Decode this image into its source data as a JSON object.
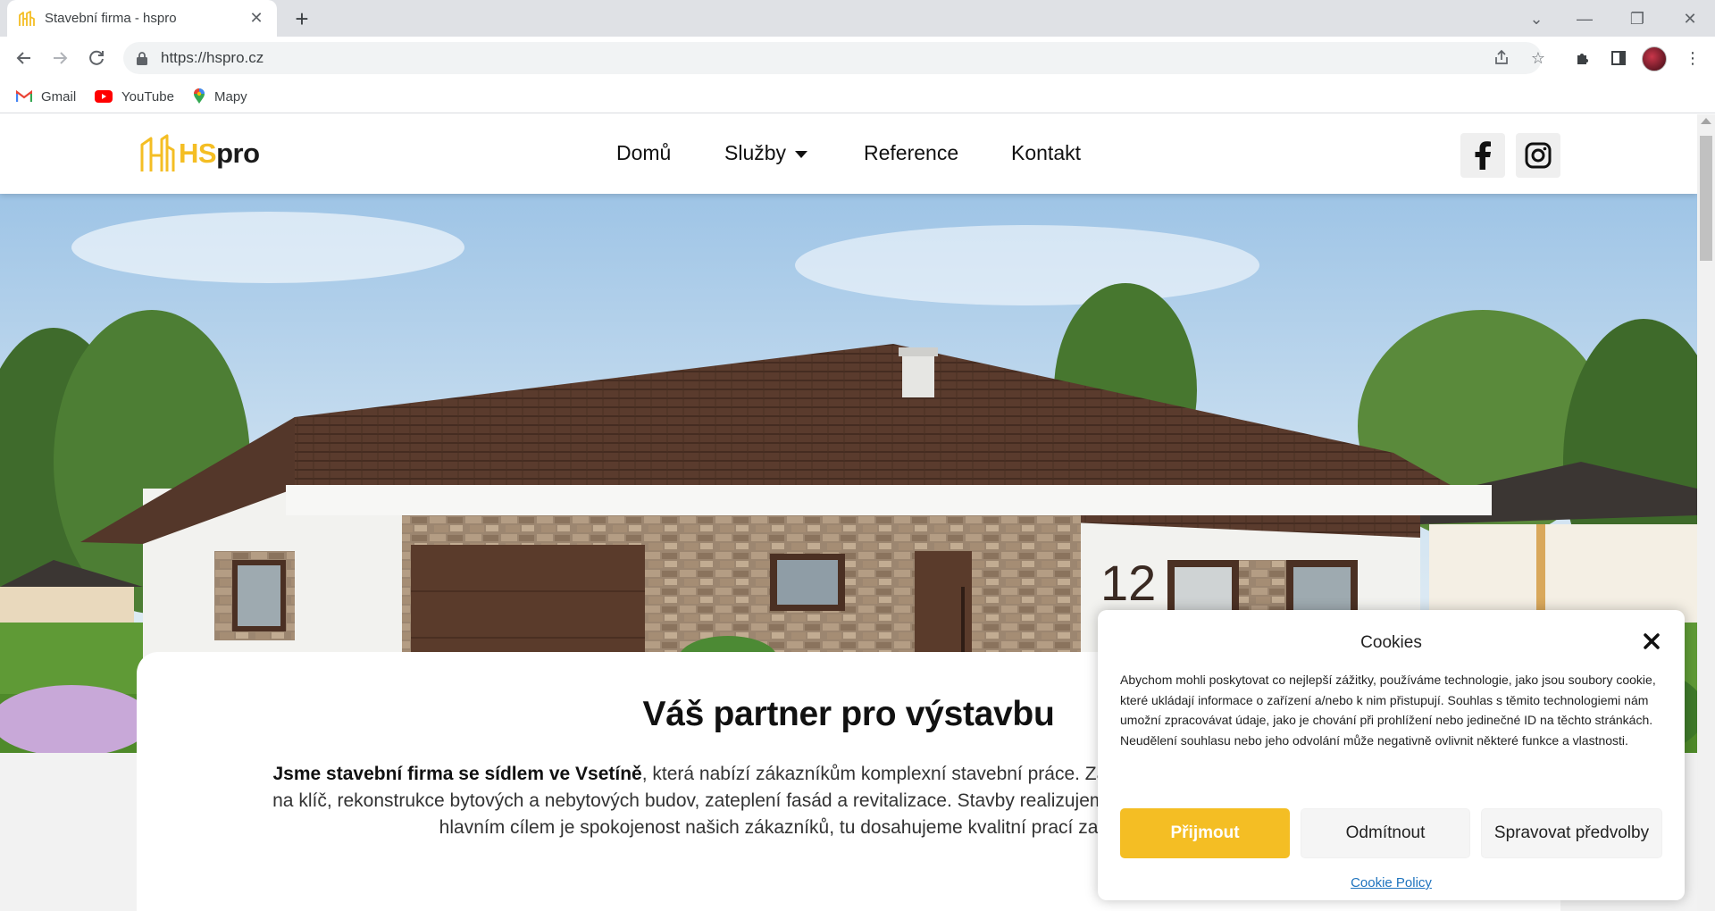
{
  "browser": {
    "tab_title": "Stavební firma - hspro",
    "url": "https://hspro.cz",
    "bookmarks": [
      {
        "label": "Gmail",
        "icon": "gmail-icon"
      },
      {
        "label": "YouTube",
        "icon": "youtube-icon"
      },
      {
        "label": "Mapy",
        "icon": "maps-pin-icon"
      }
    ]
  },
  "site": {
    "logo": {
      "hs": "HS",
      "pro": "pro"
    },
    "nav": [
      {
        "label": "Domů"
      },
      {
        "label": "Služby",
        "has_dropdown": true
      },
      {
        "label": "Reference"
      },
      {
        "label": "Kontakt"
      }
    ],
    "social": [
      "facebook-icon",
      "instagram-icon"
    ],
    "house_number": "12",
    "hero_heading": "Váš partner pro výstavbu",
    "intro": {
      "bold_lead": "Jsme stavební firma se sídlem ve Vsetíně",
      "text": ", která nabízí zákazníkům komplexní stavební práce. Zabýváme se výstavbou rodinných domů na klíč, rekonstrukce bytových a nebytových budov, zateplení fasád a revitalizace. Stavby realizujeme z materiálů předních výrobců. Naším hlavním cílem je spokojenost našich zákazníků, tu dosahujeme kvalitní prací za přiměřenou cenou."
    },
    "colors": {
      "accent": "#f4be24",
      "link": "#1e73be"
    }
  },
  "cookies": {
    "title": "Cookies",
    "text": "Abychom mohli poskytovat co nejlepší zážitky, používáme technologie, jako jsou soubory cookie, které ukládají informace o zařízení a/nebo k nim přistupují. Souhlas s těmito technologiemi nám umožní zpracovávat údaje, jako je chování při prohlížení nebo jedinečné ID na těchto stránkách. Neudělení souhlasu nebo jeho odvolání může negativně ovlivnit některé funkce a vlastnosti.",
    "accept": "Přijmout",
    "deny": "Odmítnout",
    "preferences": "Spravovat předvolby",
    "policy_link": "Cookie Policy"
  }
}
